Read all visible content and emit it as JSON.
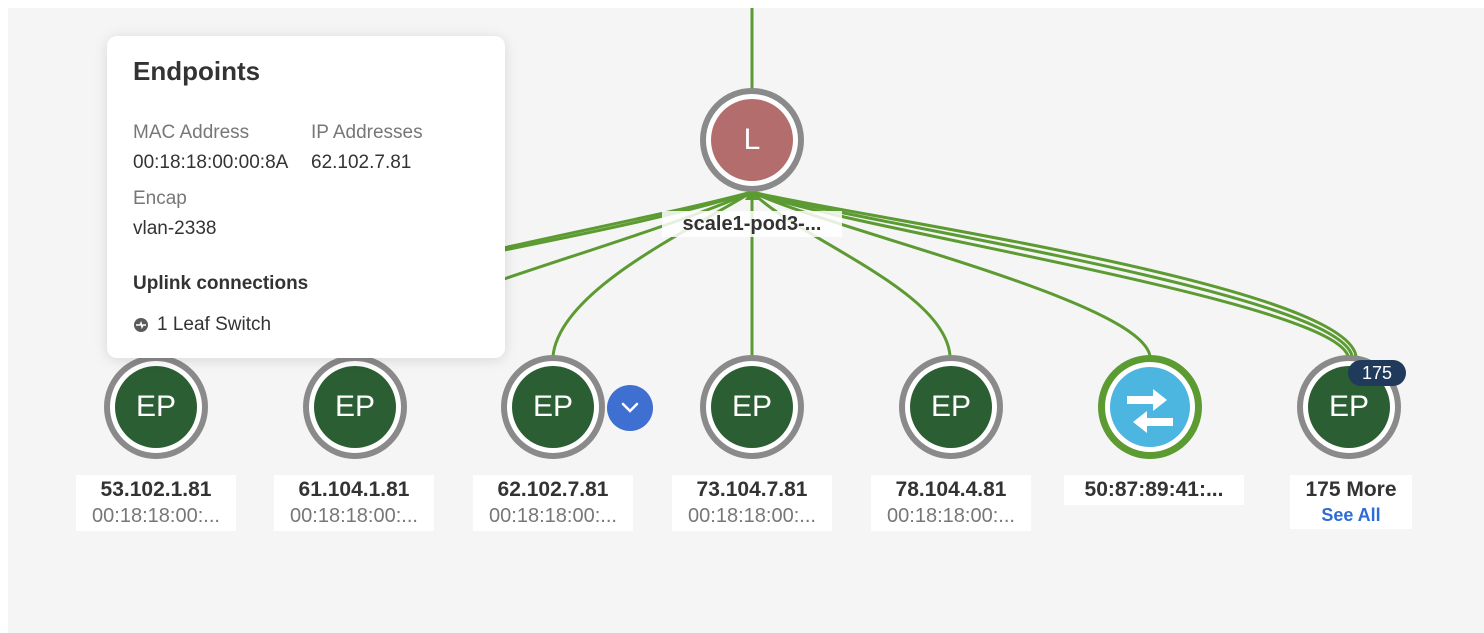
{
  "topology": {
    "leaf": {
      "letter": "L",
      "name": "scale1-pod3-..."
    },
    "endpoints": [
      {
        "glyph": "EP",
        "ip": "53.102.1.81",
        "mac": "00:18:18:00:..."
      },
      {
        "glyph": "EP",
        "ip": "61.104.1.81",
        "mac": "00:18:18:00:..."
      },
      {
        "glyph": "EP",
        "ip": "62.102.7.81",
        "mac": "00:18:18:00:..."
      },
      {
        "glyph": "EP",
        "ip": "73.104.7.81",
        "mac": "00:18:18:00:..."
      },
      {
        "glyph": "EP",
        "ip": "78.104.4.81",
        "mac": "00:18:18:00:..."
      }
    ],
    "switch_node": {
      "label": "50:87:89:41:...",
      "icon": "switch-arrows-icon"
    },
    "more": {
      "glyph": "EP",
      "badge": "175",
      "label": "175 More",
      "link": "See All"
    }
  },
  "tooltip": {
    "title": "Endpoints",
    "mac_label": "MAC Address",
    "mac_value": "00:18:18:00:00:8A",
    "ip_label": "IP Addresses",
    "ip_value": "62.102.7.81",
    "encap_label": "Encap",
    "encap_value": "vlan-2338",
    "uplink_title": "Uplink connections",
    "uplink_value": "1 Leaf Switch",
    "uplink_icon": "leaf-switch-icon"
  },
  "colors": {
    "link": "#5c9a32",
    "endpoint": "#2b5e32",
    "leaf": "#b36d6d",
    "switch": "#4cb5e0",
    "badge": "#1f3a5a",
    "expand": "#3f6fd1"
  }
}
